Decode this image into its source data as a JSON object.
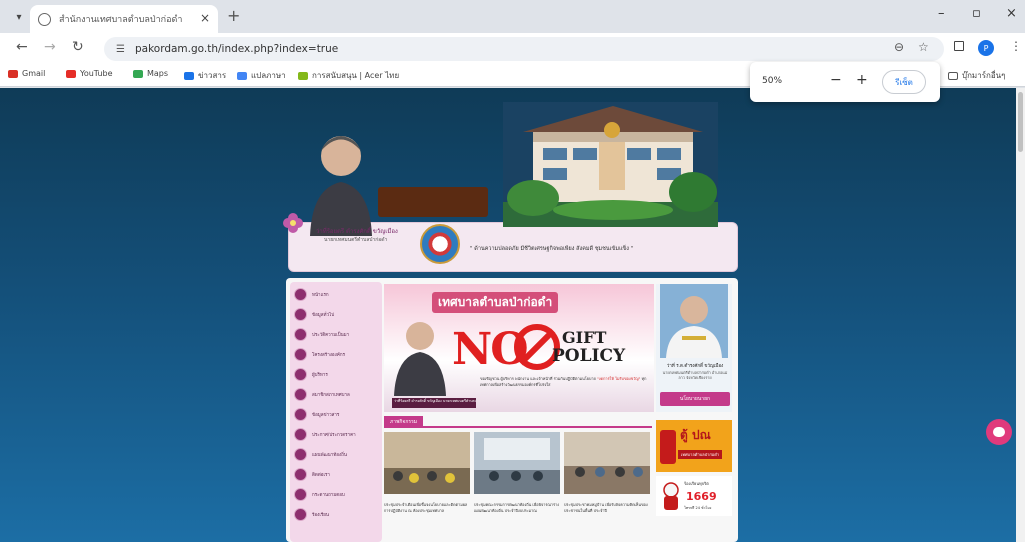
{
  "browser": {
    "tab_title": "สำนักงานเทศบาลตำบลป่าก่อดำ",
    "url": "pakordam.go.th/index.php?index=true",
    "tab_close": "×",
    "new_tab": "+",
    "minimize": "–",
    "restore": "▫",
    "close": "×",
    "profile_initial": "P"
  },
  "bookmarks": [
    {
      "label": "Gmail",
      "color": "#d93025"
    },
    {
      "label": "YouTube",
      "color": "#e52d27"
    },
    {
      "label": "Maps",
      "color": "#34a853"
    },
    {
      "label": "ข่าวสาร",
      "color": "#1a73e8"
    },
    {
      "label": "แปลภาษา",
      "color": "#4285f4"
    },
    {
      "label": "การสนับสนุน | Acer ไทย",
      "color": "#83b81a"
    }
  ],
  "bookmarks_folder": "บุ๊กมาร์กอื่นๆ",
  "zoom": {
    "level": "50%",
    "minus": "−",
    "plus": "+",
    "reset_label": "รีเซ็ต"
  },
  "banner": {
    "mayor_name": "ว่าที่ร้อยตรี ดำรงศักดิ์ ขวัญเมือง",
    "mayor_role": "นายกเทศมนตรีตำบลป่าก่อดำ",
    "slogan": "\" ด้านความปลอดภัย มีชีวิตเศรษฐกิจพอเพียง สังคมดี ชุมชนเข้มแข็ง \""
  },
  "sidebar": {
    "items": [
      {
        "label": "หน้าแรก"
      },
      {
        "label": "ข้อมูลทั่วไป"
      },
      {
        "label": "ประวัติความเป็นมา"
      },
      {
        "label": "โครงสร้างองค์กร"
      },
      {
        "label": "ผู้บริหาร"
      },
      {
        "label": "สมาชิกสภาเทศบาล"
      },
      {
        "label": "ข้อมูลข่าวสาร"
      },
      {
        "label": "ประกาศ/ประกวดราคา"
      },
      {
        "label": "แผนพัฒนาท้องถิ่น"
      },
      {
        "label": "ติดต่อเรา"
      },
      {
        "label": "กระดานถามตอบ"
      },
      {
        "label": "ร้องเรียน"
      }
    ]
  },
  "hero": {
    "title": "เทศบาลตำบลป่าก่อดำ",
    "no": "NO",
    "gift": "GIFT",
    "policy": "POLICY",
    "caption": "ว่าที่ร้อยตรี ดำรงศักดิ์ ขวัญเมือง นายกเทศมนตรีตำบลป่าก่อดำ",
    "desc_before": "ขอเชิญชวน ผู้บริหาร พนักงาน และเจ้าหน้าที่ ร่วมกันปฏิบัติตามนโยบาย",
    "desc_quote": "\"งดการให้ ไม่รับของขวัญ\"",
    "desc_after": "ทุกเทศกาลเพื่อสร้างวัฒนธรรมองค์กรที่โปร่งใส"
  },
  "profile": {
    "name": "ว่าที่ ร.ต.ดำรงศักดิ์ ขวัญเมือง",
    "role": "นายกเทศมนตรีตำบลป่าก่อดำ อำเภอแม่ลาว จังหวัดเชียงราย",
    "button": "นโยบายนายก"
  },
  "news": {
    "section_title": "ภาพกิจกรรม",
    "items": [
      {
        "text": "ประชุมประจำเดือนเพื่อชี้แจงนโยบายและติดตามผลการปฏิบัติงาน ณ ห้องประชุมเทศบาล"
      },
      {
        "text": "ประชุมคณะกรรมการพัฒนาท้องถิ่น เพื่อพิจารณาร่างแผนพัฒนาท้องถิ่น ประจำปีงบประมาณ"
      },
      {
        "text": "ประชุมประชาคมหมู่บ้าน เพื่อรับฟังความคิดเห็นของประชาชนในพื้นที่ ประจำปี"
      }
    ]
  },
  "ads": {
    "mailbox_title": "ตู้ ปณ",
    "mailbox_sub": "เทศบาลตำบลป่าก่อดำ",
    "hotline_top": "ร้องเรียนทุจริต",
    "hotline_number": "1669",
    "hotline_bottom": "โทรฟรี 24 ชั่วโมง"
  },
  "colors": {
    "accent": "#c43a8a",
    "page_bg_top": "#0f3b57",
    "page_bg_bottom": "#1c6ea5"
  }
}
